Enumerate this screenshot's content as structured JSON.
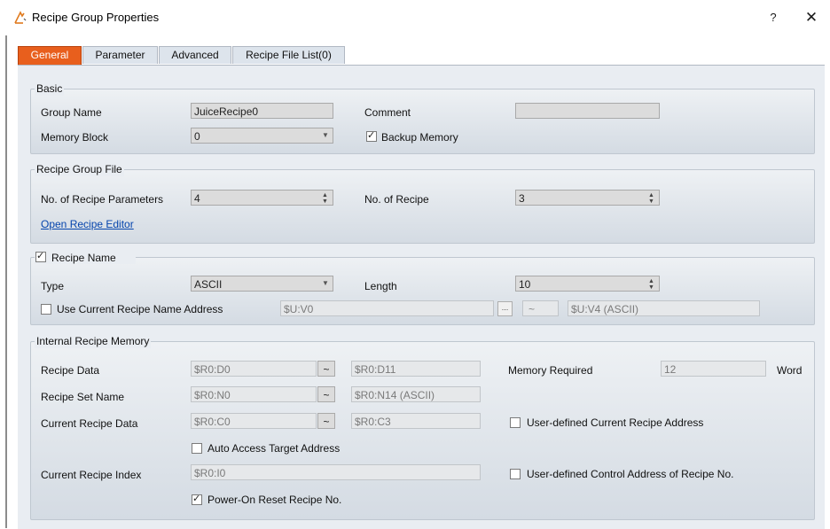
{
  "window": {
    "title": "Recipe Group Properties",
    "help": "?",
    "close": "✕"
  },
  "tabs": [
    "General",
    "Parameter",
    "Advanced",
    "Recipe File List(0)"
  ],
  "basic": {
    "title": "Basic",
    "group_name_label": "Group Name",
    "group_name": "JuiceRecipe0",
    "comment_label": "Comment",
    "comment": "",
    "memory_block_label": "Memory Block",
    "memory_block": "0",
    "backup_memory_label": "Backup Memory"
  },
  "file": {
    "title": "Recipe Group File",
    "params_label": "No. of Recipe Parameters",
    "params": "4",
    "recipes_label": "No. of Recipe",
    "recipes": "3",
    "editor_link": "Open Recipe Editor"
  },
  "name": {
    "title": "Recipe Name",
    "type_label": "Type",
    "type": "ASCII",
    "length_label": "Length",
    "length": "10",
    "use_addr_label": "Use Current Recipe Name Address",
    "addr_start": "$U:V0",
    "addr_end": "$U:V4 (ASCII)",
    "tilde": "~",
    "browse": "..."
  },
  "memory": {
    "title": "Internal Recipe Memory",
    "data_label": "Recipe Data",
    "data_start": "$R0:D0",
    "data_end": "$R0:D11",
    "required_label": "Memory Required",
    "required": "12",
    "unit": "Word",
    "set_label": "Recipe Set Name",
    "set_start": "$R0:N0",
    "set_end": "$R0:N14 (ASCII)",
    "cur_label": "Current Recipe Data",
    "cur_start": "$R0:C0",
    "cur_end": "$R0:C3",
    "user_cur_label": "User-defined Current Recipe Address",
    "auto_label": "Auto Access Target Address",
    "index_label": "Current Recipe Index",
    "index": "$R0:I0",
    "user_ctrl_label": "User-defined Control Address of Recipe No.",
    "reset_label": "Power-On Reset Recipe No.",
    "tilde": "~"
  },
  "colors": {
    "active_tab": "#e85f1d",
    "link": "#0645ad"
  }
}
